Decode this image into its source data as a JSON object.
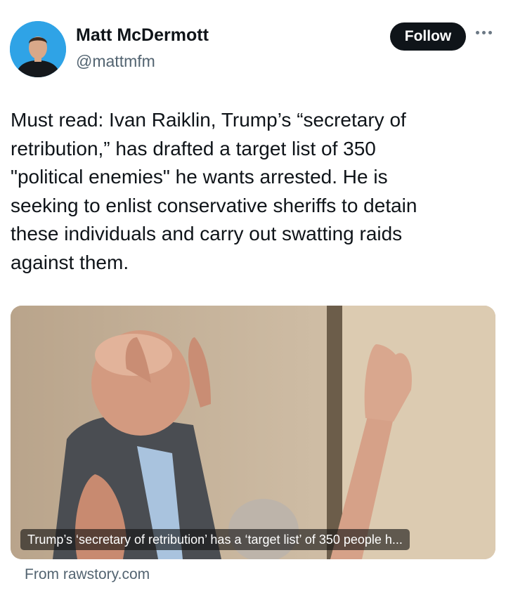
{
  "author": {
    "name": "Matt McDermott",
    "handle": "@mattmfm",
    "avatar_icon": "profile-photo"
  },
  "actions": {
    "follow_label": "Follow",
    "more_icon": "more-horizontal-icon"
  },
  "tweet": {
    "text": "Must read: Ivan Raiklin, Trump’s “secretary of\nretribution,” has drafted a target list of 350\n\"political enemies\" he wants arrested. He is\nseeking to enlist conservative sheriffs to detain\nthese individuals and carry out swatting raids\nagainst them."
  },
  "card": {
    "caption": "Trump’s ‘secretary of retribution’ has a ‘target list’ of 350 people h...",
    "source": "From rawstory.com"
  },
  "colors": {
    "text": "#0f1419",
    "secondary_text": "#536471",
    "button_bg": "#0f1419",
    "avatar_bg": "#2fa3e6"
  }
}
